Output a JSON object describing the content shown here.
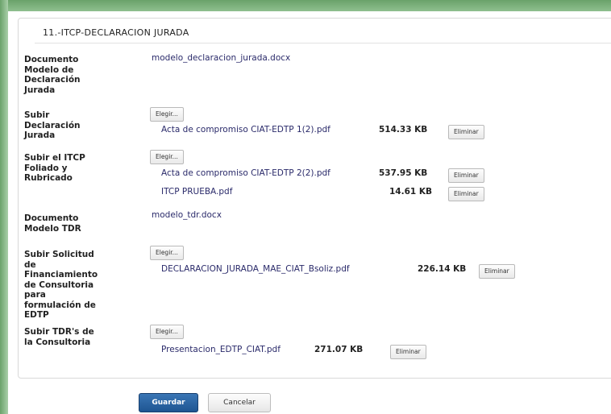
{
  "section": {
    "title": "11.-ITCP-DECLARACION JURADA"
  },
  "rows": {
    "doc_modelo": {
      "label": "Documento\nModelo de\nDeclaración\nJurada",
      "file": "modelo_declaracion_jurada.docx"
    },
    "subir_decl": {
      "label": "Subir\nDeclaración\nJurada",
      "choose": "Elegir...",
      "files": [
        {
          "name": "Acta de compromiso CIAT-EDTP 1(2).pdf",
          "size": "514.33 KB",
          "delete": "Eliminar"
        }
      ]
    },
    "subir_itcp": {
      "label": "Subir el ITCP\nFoliado y\nRubricado",
      "choose": "Elegir...",
      "files": [
        {
          "name": "Acta de compromiso CIAT-EDTP 2(2).pdf",
          "size": "537.95 KB",
          "delete": "Eliminar"
        },
        {
          "name": "ITCP PRUEBA.pdf",
          "size": "14.61 KB",
          "delete": "Eliminar"
        }
      ]
    },
    "doc_tdr": {
      "label": "Documento\nModelo TDR",
      "file": "modelo_tdr.docx"
    },
    "subir_solicitud": {
      "label": "Subir Solicitud\nde\nFinanciamiento\nde Consultoria\npara\nformulación de\nEDTP",
      "choose": "Elegir...",
      "files": [
        {
          "name": "DECLARACION_JURADA_MAE_CIAT_Bsoliz.pdf",
          "size": "226.14 KB",
          "delete": "Eliminar"
        }
      ]
    },
    "subir_tdr": {
      "label": "Subir TDR's de\nla Consultoria",
      "choose": "Elegir...",
      "files": [
        {
          "name": "Presentacion_EDTP_CIAT.pdf",
          "size": "271.07 KB",
          "delete": "Eliminar"
        }
      ]
    }
  },
  "actions": {
    "save": "Guardar",
    "cancel": "Cancelar"
  },
  "colors": {
    "save_button": "#1e5592",
    "frame": "#6aa26a"
  }
}
